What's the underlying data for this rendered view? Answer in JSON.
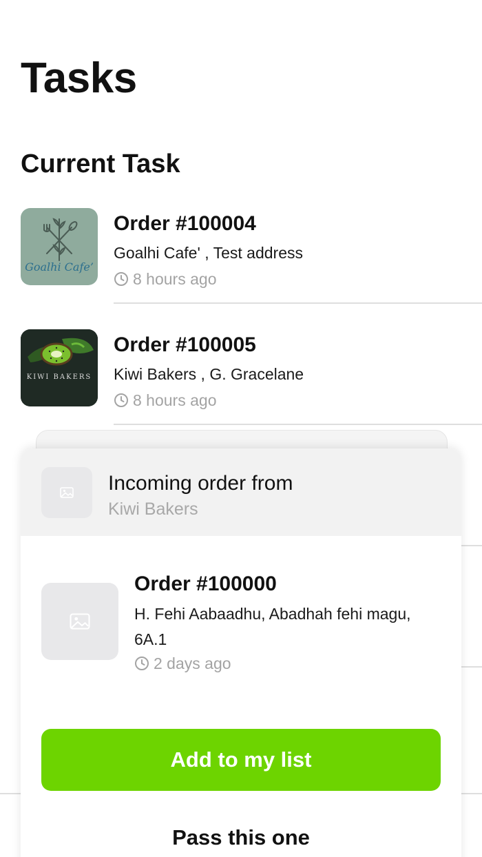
{
  "page": {
    "title": "Tasks",
    "section_title": "Current Task"
  },
  "tasks": [
    {
      "order": "Order #100004",
      "address": "Goalhi Cafe' , Test address",
      "time": "8 hours ago",
      "logo_text": "Goalhi Cafe’",
      "logo_icon": "fork-knife-leaf-icon",
      "logo_bg": "#8fab9d"
    },
    {
      "order": "Order #100005",
      "address": "Kiwi Bakers , G. Gracelane",
      "time": "8 hours ago",
      "logo_text": "KIWI BAKERS",
      "logo_icon": "kiwi-slice-icon",
      "logo_bg": "#1f2a24"
    }
  ],
  "incoming": {
    "heading": "Incoming order from",
    "from": "Kiwi Bakers",
    "order": "Order #100000",
    "address": "H. Fehi Aabaadhu, Abadhah fehi magu, 6A.1",
    "time": "2 days ago",
    "placeholder_icon": "image-placeholder-icon",
    "add_label": "Add to my list",
    "pass_label": "Pass this one"
  },
  "colors": {
    "accent": "#6dd400",
    "muted_text": "#a3a3a3",
    "divider": "#dedede"
  }
}
